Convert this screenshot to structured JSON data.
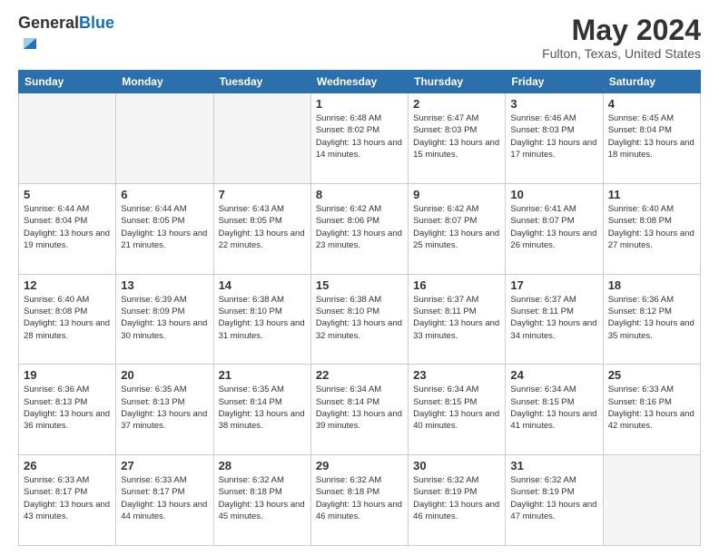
{
  "header": {
    "logo_general": "General",
    "logo_blue": "Blue",
    "month_year": "May 2024",
    "location": "Fulton, Texas, United States"
  },
  "weekdays": [
    "Sunday",
    "Monday",
    "Tuesday",
    "Wednesday",
    "Thursday",
    "Friday",
    "Saturday"
  ],
  "weeks": [
    [
      {
        "day": "",
        "info": ""
      },
      {
        "day": "",
        "info": ""
      },
      {
        "day": "",
        "info": ""
      },
      {
        "day": "1",
        "info": "Sunrise: 6:48 AM\nSunset: 8:02 PM\nDaylight: 13 hours and 14 minutes."
      },
      {
        "day": "2",
        "info": "Sunrise: 6:47 AM\nSunset: 8:03 PM\nDaylight: 13 hours and 15 minutes."
      },
      {
        "day": "3",
        "info": "Sunrise: 6:46 AM\nSunset: 8:03 PM\nDaylight: 13 hours and 17 minutes."
      },
      {
        "day": "4",
        "info": "Sunrise: 6:45 AM\nSunset: 8:04 PM\nDaylight: 13 hours and 18 minutes."
      }
    ],
    [
      {
        "day": "5",
        "info": "Sunrise: 6:44 AM\nSunset: 8:04 PM\nDaylight: 13 hours and 19 minutes."
      },
      {
        "day": "6",
        "info": "Sunrise: 6:44 AM\nSunset: 8:05 PM\nDaylight: 13 hours and 21 minutes."
      },
      {
        "day": "7",
        "info": "Sunrise: 6:43 AM\nSunset: 8:05 PM\nDaylight: 13 hours and 22 minutes."
      },
      {
        "day": "8",
        "info": "Sunrise: 6:42 AM\nSunset: 8:06 PM\nDaylight: 13 hours and 23 minutes."
      },
      {
        "day": "9",
        "info": "Sunrise: 6:42 AM\nSunset: 8:07 PM\nDaylight: 13 hours and 25 minutes."
      },
      {
        "day": "10",
        "info": "Sunrise: 6:41 AM\nSunset: 8:07 PM\nDaylight: 13 hours and 26 minutes."
      },
      {
        "day": "11",
        "info": "Sunrise: 6:40 AM\nSunset: 8:08 PM\nDaylight: 13 hours and 27 minutes."
      }
    ],
    [
      {
        "day": "12",
        "info": "Sunrise: 6:40 AM\nSunset: 8:08 PM\nDaylight: 13 hours and 28 minutes."
      },
      {
        "day": "13",
        "info": "Sunrise: 6:39 AM\nSunset: 8:09 PM\nDaylight: 13 hours and 30 minutes."
      },
      {
        "day": "14",
        "info": "Sunrise: 6:38 AM\nSunset: 8:10 PM\nDaylight: 13 hours and 31 minutes."
      },
      {
        "day": "15",
        "info": "Sunrise: 6:38 AM\nSunset: 8:10 PM\nDaylight: 13 hours and 32 minutes."
      },
      {
        "day": "16",
        "info": "Sunrise: 6:37 AM\nSunset: 8:11 PM\nDaylight: 13 hours and 33 minutes."
      },
      {
        "day": "17",
        "info": "Sunrise: 6:37 AM\nSunset: 8:11 PM\nDaylight: 13 hours and 34 minutes."
      },
      {
        "day": "18",
        "info": "Sunrise: 6:36 AM\nSunset: 8:12 PM\nDaylight: 13 hours and 35 minutes."
      }
    ],
    [
      {
        "day": "19",
        "info": "Sunrise: 6:36 AM\nSunset: 8:13 PM\nDaylight: 13 hours and 36 minutes."
      },
      {
        "day": "20",
        "info": "Sunrise: 6:35 AM\nSunset: 8:13 PM\nDaylight: 13 hours and 37 minutes."
      },
      {
        "day": "21",
        "info": "Sunrise: 6:35 AM\nSunset: 8:14 PM\nDaylight: 13 hours and 38 minutes."
      },
      {
        "day": "22",
        "info": "Sunrise: 6:34 AM\nSunset: 8:14 PM\nDaylight: 13 hours and 39 minutes."
      },
      {
        "day": "23",
        "info": "Sunrise: 6:34 AM\nSunset: 8:15 PM\nDaylight: 13 hours and 40 minutes."
      },
      {
        "day": "24",
        "info": "Sunrise: 6:34 AM\nSunset: 8:15 PM\nDaylight: 13 hours and 41 minutes."
      },
      {
        "day": "25",
        "info": "Sunrise: 6:33 AM\nSunset: 8:16 PM\nDaylight: 13 hours and 42 minutes."
      }
    ],
    [
      {
        "day": "26",
        "info": "Sunrise: 6:33 AM\nSunset: 8:17 PM\nDaylight: 13 hours and 43 minutes."
      },
      {
        "day": "27",
        "info": "Sunrise: 6:33 AM\nSunset: 8:17 PM\nDaylight: 13 hours and 44 minutes."
      },
      {
        "day": "28",
        "info": "Sunrise: 6:32 AM\nSunset: 8:18 PM\nDaylight: 13 hours and 45 minutes."
      },
      {
        "day": "29",
        "info": "Sunrise: 6:32 AM\nSunset: 8:18 PM\nDaylight: 13 hours and 46 minutes."
      },
      {
        "day": "30",
        "info": "Sunrise: 6:32 AM\nSunset: 8:19 PM\nDaylight: 13 hours and 46 minutes."
      },
      {
        "day": "31",
        "info": "Sunrise: 6:32 AM\nSunset: 8:19 PM\nDaylight: 13 hours and 47 minutes."
      },
      {
        "day": "",
        "info": ""
      }
    ]
  ]
}
